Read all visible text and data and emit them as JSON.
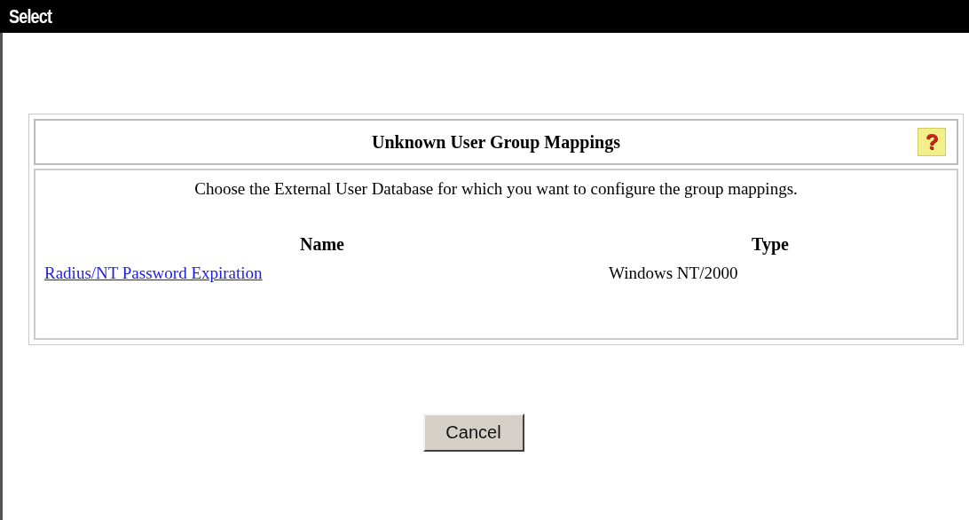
{
  "window": {
    "title": "Select"
  },
  "panel": {
    "title": "Unknown User Group Mappings",
    "help": "?",
    "description": "Choose the External User Database for which you want to configure the group mappings.",
    "columns": [
      "Name",
      "Type"
    ],
    "rows": [
      {
        "name": "Radius/NT Password Expiration",
        "type": "Windows NT/2000"
      }
    ]
  },
  "buttons": [
    "Cancel"
  ]
}
